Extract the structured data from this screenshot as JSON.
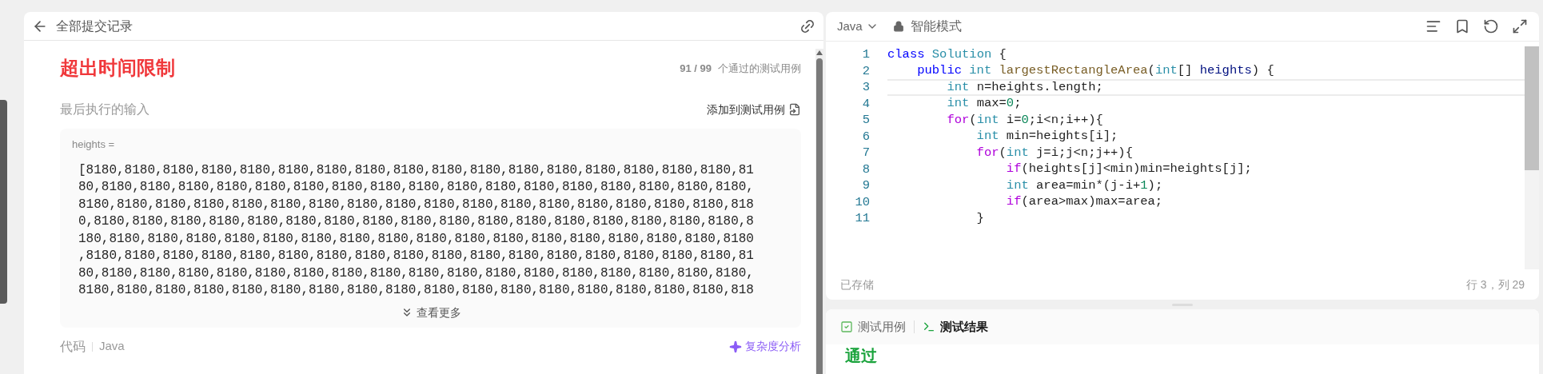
{
  "submission": {
    "back_label": "全部提交记录",
    "status": "超出时间限制",
    "passed": "91 / 99",
    "passed_label": "个通过的测试用例",
    "last_input_label": "最后执行的输入",
    "add_to_tests": "添加到测试用例",
    "input_name": "heights =",
    "input_lines": [
      "[8180,8180,8180,8180,8180,8180,8180,8180,8180,8180,8180,8180,8180,8180,8180,8180,8180,81",
      "80,8180,8180,8180,8180,8180,8180,8180,8180,8180,8180,8180,8180,8180,8180,8180,8180,8180,",
      "8180,8180,8180,8180,8180,8180,8180,8180,8180,8180,8180,8180,8180,8180,8180,8180,8180,818",
      "0,8180,8180,8180,8180,8180,8180,8180,8180,8180,8180,8180,8180,8180,8180,8180,8180,8180,8",
      "180,8180,8180,8180,8180,8180,8180,8180,8180,8180,8180,8180,8180,8180,8180,8180,8180,8180",
      ",8180,8180,8180,8180,8180,8180,8180,8180,8180,8180,8180,8180,8180,8180,8180,8180,8180,81",
      "80,8180,8180,8180,8180,8180,8180,8180,8180,8180,8180,8180,8180,8180,8180,8180,8180,8180,",
      "8180,8180,8180,8180,8180,8180,8180,8180,8180,8180,8180,8180,8180,8180,8180,8180,8180,818"
    ],
    "show_more": "查看更多",
    "code_label": "代码",
    "code_lang": "Java",
    "complexity": "复杂度分析"
  },
  "editor": {
    "language": "Java",
    "mode": "智能模式",
    "saved": "已存储",
    "cursor": "行 3，列 29",
    "lines": [
      {
        "number": "1",
        "current": false,
        "tokens": [
          {
            "text": "class",
            "kind": "keyword"
          },
          {
            "text": " Solution",
            "kind": "type"
          },
          {
            "text": " {",
            "kind": "plain"
          }
        ]
      },
      {
        "number": "2",
        "current": false,
        "tokens": [
          {
            "text": "    public",
            "kind": "keyword"
          },
          {
            "text": " int",
            "kind": "type"
          },
          {
            "text": " largestRectangleArea",
            "kind": "function"
          },
          {
            "text": "(",
            "kind": "plain"
          },
          {
            "text": "int",
            "kind": "type"
          },
          {
            "text": "[] ",
            "kind": "plain"
          },
          {
            "text": "heights",
            "kind": "param"
          },
          {
            "text": ") {",
            "kind": "plain"
          }
        ]
      },
      {
        "number": "3",
        "current": true,
        "tokens": [
          {
            "text": "        int",
            "kind": "type"
          },
          {
            "text": " n=heights.length;",
            "kind": "plain"
          }
        ]
      },
      {
        "number": "4",
        "current": false,
        "tokens": [
          {
            "text": "        int",
            "kind": "type"
          },
          {
            "text": " max=",
            "kind": "plain"
          },
          {
            "text": "0",
            "kind": "number"
          },
          {
            "text": ";",
            "kind": "plain"
          }
        ]
      },
      {
        "number": "5",
        "current": false,
        "tokens": [
          {
            "text": "        for",
            "kind": "control"
          },
          {
            "text": "(",
            "kind": "plain"
          },
          {
            "text": "int",
            "kind": "type"
          },
          {
            "text": " i=",
            "kind": "plain"
          },
          {
            "text": "0",
            "kind": "number"
          },
          {
            "text": ";i<n;i++){",
            "kind": "plain"
          }
        ]
      },
      {
        "number": "6",
        "current": false,
        "tokens": [
          {
            "text": "            int",
            "kind": "type"
          },
          {
            "text": " min=heights[i];",
            "kind": "plain"
          }
        ]
      },
      {
        "number": "7",
        "current": false,
        "tokens": [
          {
            "text": "            for",
            "kind": "control"
          },
          {
            "text": "(",
            "kind": "plain"
          },
          {
            "text": "int",
            "kind": "type"
          },
          {
            "text": " j=i;j<n;j++){",
            "kind": "plain"
          }
        ]
      },
      {
        "number": "8",
        "current": false,
        "tokens": [
          {
            "text": "                if",
            "kind": "control"
          },
          {
            "text": "(heights[j]<min)min=heights[j];",
            "kind": "plain"
          }
        ]
      },
      {
        "number": "9",
        "current": false,
        "tokens": [
          {
            "text": "                int",
            "kind": "type"
          },
          {
            "text": " area=min*(j-i+",
            "kind": "plain"
          },
          {
            "text": "1",
            "kind": "number"
          },
          {
            "text": ");",
            "kind": "plain"
          }
        ]
      },
      {
        "number": "10",
        "current": false,
        "tokens": [
          {
            "text": "                if",
            "kind": "control"
          },
          {
            "text": "(area>max)max=area;",
            "kind": "plain"
          }
        ]
      },
      {
        "number": "11",
        "current": false,
        "tokens": [
          {
            "text": "            }",
            "kind": "plain"
          }
        ]
      }
    ]
  },
  "test_panel": {
    "tabs": [
      {
        "label": "测试用例",
        "kind": "cases",
        "selected": false
      },
      {
        "label": "测试结果",
        "kind": "result",
        "selected": true
      }
    ],
    "result": "通过"
  }
}
